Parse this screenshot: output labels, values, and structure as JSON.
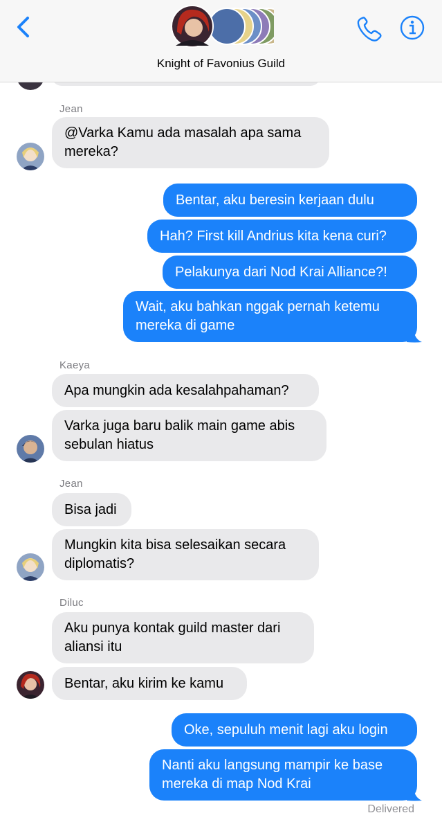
{
  "header": {
    "title": "Knight of Favonius Guild"
  },
  "messages": [
    {
      "sender": "Jean",
      "text": "@Varka Kamu ada masalah apa sama\nmereka?"
    },
    {
      "text": "Bentar, aku beresin kerjaan dulu"
    },
    {
      "text": "Hah? First kill Andrius kita kena curi?"
    },
    {
      "text": "Pelakunya dari Nod Krai Alliance?!"
    },
    {
      "text": "Wait, aku bahkan nggak pernah ketemu\nmereka di game"
    },
    {
      "sender": "Kaeya",
      "text": "Apa mungkin ada kesalahpahaman?"
    },
    {
      "text": "Varka juga baru balik main game abis\nsebulan hiatus"
    },
    {
      "sender": "Jean",
      "text": "Bisa jadi"
    },
    {
      "text": "Mungkin kita bisa selesaikan secara\ndiplomatis?"
    },
    {
      "sender": "Diluc",
      "text": "Aku punya kontak guild master dari\naliansi itu"
    },
    {
      "text": "Bentar, aku kirim ke kamu"
    },
    {
      "text": "Oke, sepuluh menit lagi aku login"
    },
    {
      "text": "Nanti aku langsung mampir ke base\nmereka di map Nod Krai"
    }
  ],
  "status": "Delivered",
  "colors": {
    "accent": "#1b82fa",
    "incoming_bubble": "#e9e9eb",
    "header_bg": "#f7f7f7"
  },
  "icons": [
    "back-chevron-icon",
    "phone-icon",
    "info-icon"
  ]
}
